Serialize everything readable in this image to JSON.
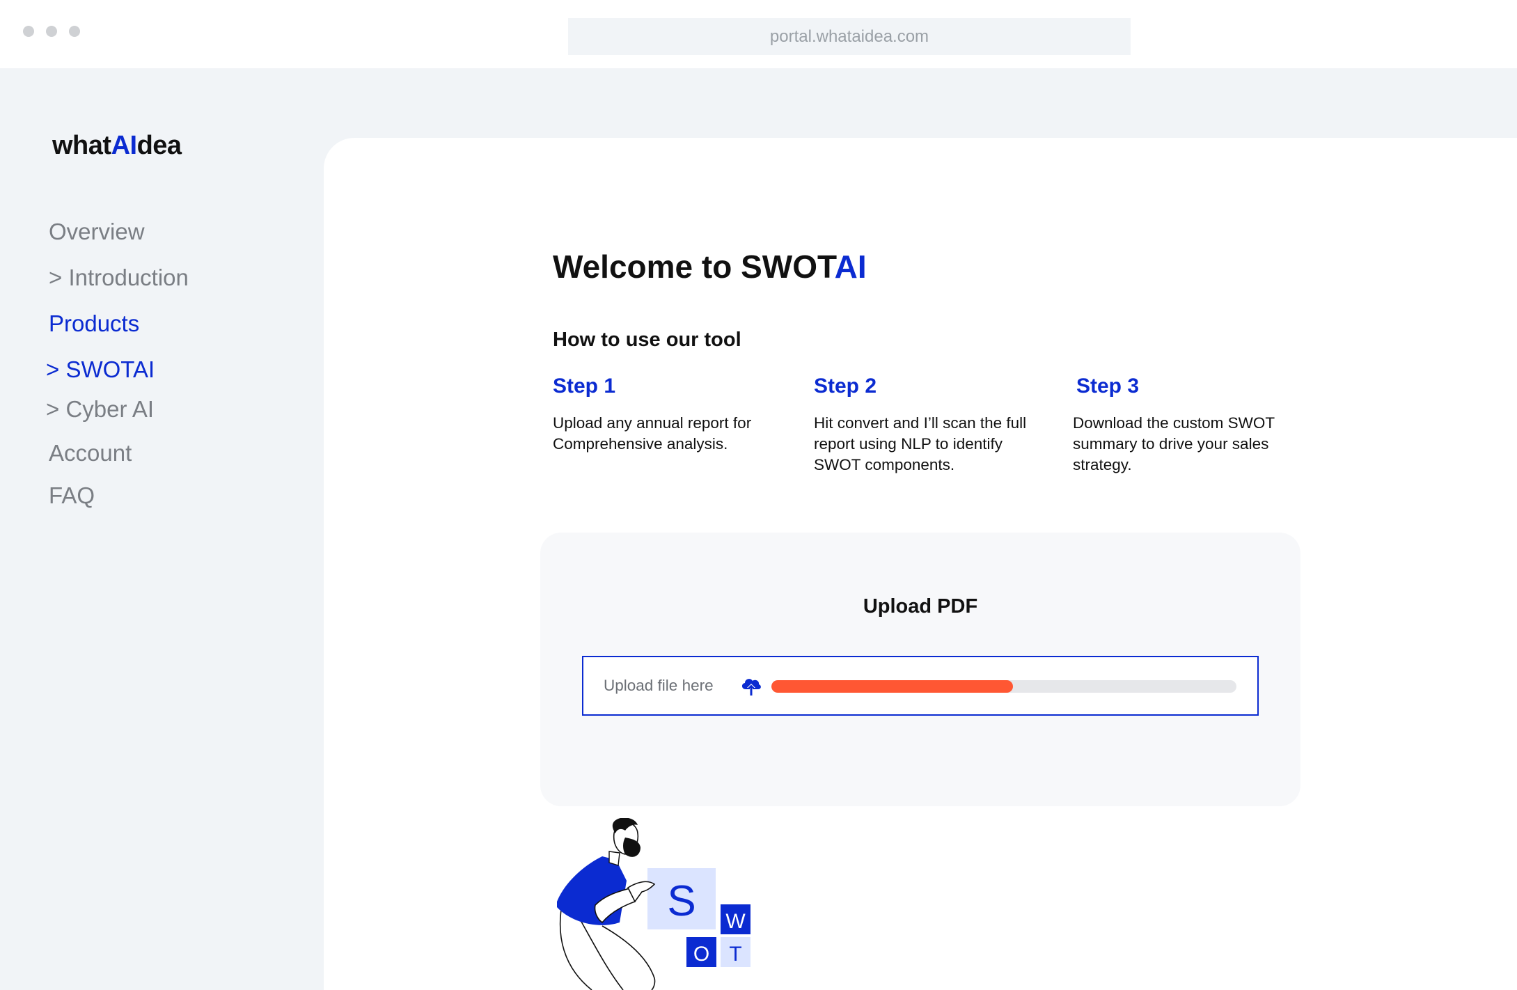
{
  "browser": {
    "url": "portal.whataidea.com"
  },
  "logo": {
    "prefix": "what",
    "accent": "AI",
    "suffix": "dea"
  },
  "sidebar": {
    "items": [
      {
        "label": "Overview",
        "active": false
      },
      {
        "label": "> Introduction",
        "active": false
      },
      {
        "label": "Products",
        "active": true
      },
      {
        "label": "> SWOTAI",
        "active": true
      },
      {
        "label": "> Cyber AI",
        "active": false
      },
      {
        "label": "Account",
        "active": false
      },
      {
        "label": "FAQ",
        "active": false
      }
    ]
  },
  "main": {
    "welcome_prefix": "Welcome to SWOT",
    "welcome_accent": "AI",
    "howto_title": "How to use our tool",
    "steps": [
      {
        "title": "Step 1",
        "desc": "Upload any annual report for Comprehensive analysis."
      },
      {
        "title": "Step 2",
        "desc": "Hit convert and I’ll scan the full report using NLP to identify SWOT components."
      },
      {
        "title": "Step 3",
        "desc": "Download the custom SWOT summary to drive your sales strategy."
      }
    ],
    "upload": {
      "title": "Upload PDF",
      "label": "Upload file here",
      "icon": "cloud-upload-icon",
      "progress_percent": 52
    },
    "illustration": {
      "letters": [
        "S",
        "W",
        "O",
        "T"
      ]
    }
  },
  "colors": {
    "accent": "#0b2bd1",
    "progress": "#ff5733",
    "track": "#e6e7ea",
    "background": "#f1f4f7"
  }
}
